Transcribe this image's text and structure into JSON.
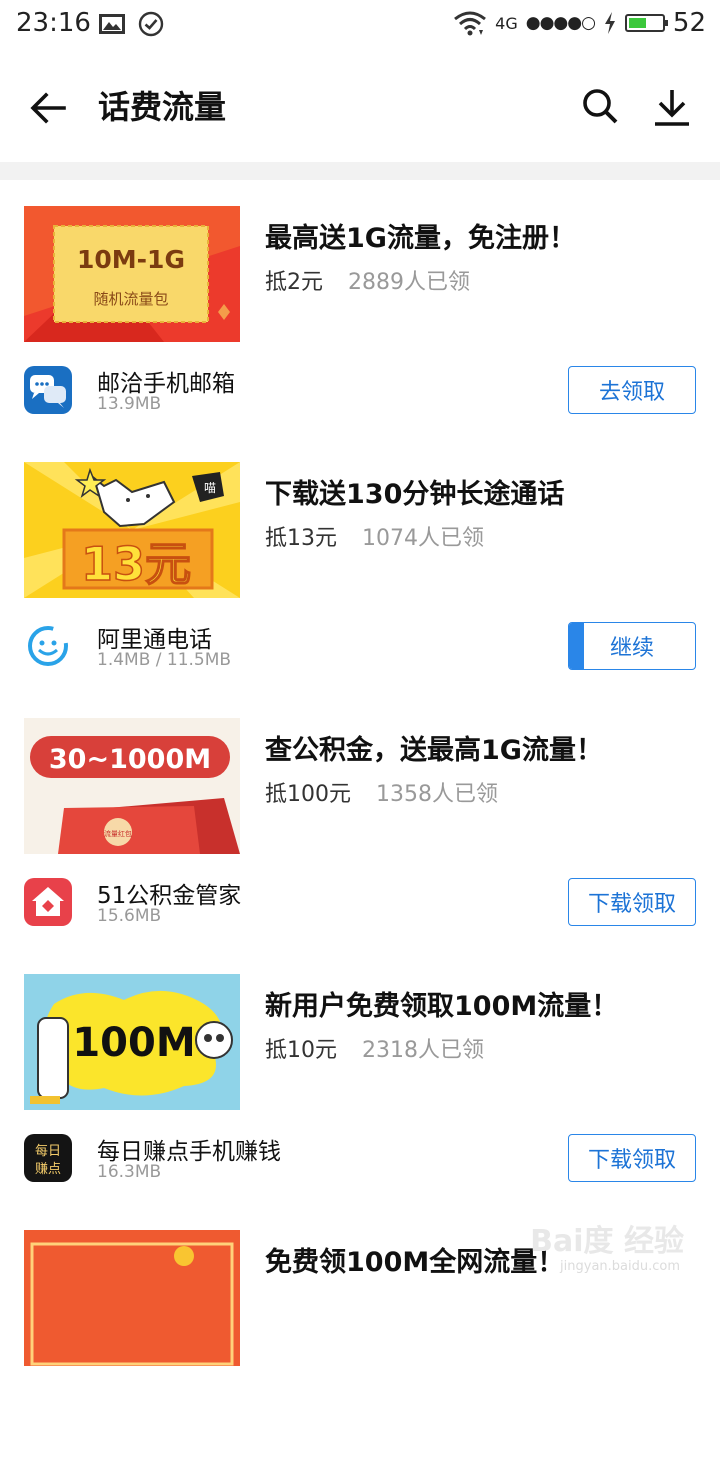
{
  "status_bar": {
    "time": "23:16",
    "network": "4G",
    "signal": "●●●●○",
    "battery_level": 0.52,
    "battery_text": "52",
    "icons": [
      "image-icon",
      "check-circle-icon",
      "wifi-icon",
      "charging-icon"
    ]
  },
  "toolbar": {
    "title": "话费流量",
    "back_icon": "back-arrow-icon",
    "search_icon": "search-icon",
    "download_icon": "download-icon"
  },
  "offers": [
    {
      "title": "最高送1G流量，免注册！",
      "price": "抵2元",
      "count": "2889人已领",
      "banner_big": "10M-1G",
      "banner_small": "随机流量包",
      "app_name": "邮洽手机邮箱",
      "app_size": "13.9MB",
      "action": "去领取",
      "progress": 0
    },
    {
      "title": "下载送130分钟长途通话",
      "price": "抵13元",
      "count": "1074人已领",
      "banner_big": "13元",
      "banner_small": "喵",
      "app_name": "阿里通电话",
      "app_size": "1.4MB / 11.5MB",
      "action": "继续",
      "progress": 0.12
    },
    {
      "title": "查公积金，送最高1G流量！",
      "price": "抵100元",
      "count": "1358人已领",
      "banner_big": "30~1000M",
      "banner_small": "流量红包",
      "app_name": "51公积金管家",
      "app_size": "15.6MB",
      "action": "下载领取",
      "progress": 0
    },
    {
      "title": "新用户免费领取100M流量！",
      "price": "抵10元",
      "count": "2318人已领",
      "banner_big": "100M",
      "banner_small": "",
      "app_name": "每日赚点手机赚钱",
      "app_size": "16.3MB",
      "app_icon_text": "每日赚点",
      "action": "下载领取",
      "progress": 0
    },
    {
      "title": "免费领100M全网流量！"
    }
  ],
  "watermark": "Bai度 经验",
  "watermark_sub": "jingyan.baidu.com",
  "colors": {
    "accent": "#2a86e8",
    "battery": "#3cc83c",
    "muted": "#999999"
  }
}
